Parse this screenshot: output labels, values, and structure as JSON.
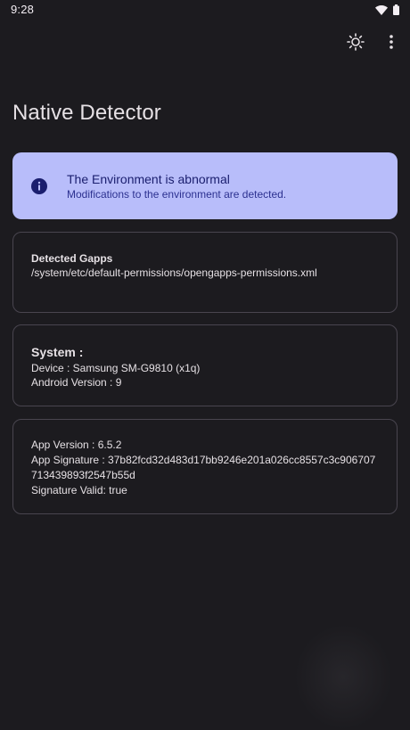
{
  "status_bar": {
    "time": "9:28"
  },
  "header": {
    "title": "Native Detector"
  },
  "alert": {
    "title": "The Environment is abnormal",
    "subtitle": "Modifications to the environment are detected."
  },
  "gapps_card": {
    "heading": "Detected Gapps",
    "path": "/system/etc/default-permissions/opengapps-permissions.xml"
  },
  "system_card": {
    "heading": "System :",
    "device": "Device : Samsung SM-G9810  (x1q)",
    "android_version": "Android Version : 9"
  },
  "app_card": {
    "app_version": "App Version : 6.5.2",
    "app_signature_line1": "App Signature : 37b82fcd32d483d17bb9246e201a026cc8557c3c906707",
    "app_signature_line2": "713439893f2547b55d",
    "signature_valid": "Signature Valid: true"
  },
  "colors": {
    "background": "#1c1b1f",
    "alert_background": "#b8bdfa",
    "alert_text": "#1a1e6e",
    "card_border": "#49454f"
  },
  "icons": {
    "status": [
      "wifi-icon",
      "battery-icon"
    ],
    "actions": [
      "brightness-icon",
      "more-vert-icon"
    ],
    "alert": "info-icon"
  }
}
